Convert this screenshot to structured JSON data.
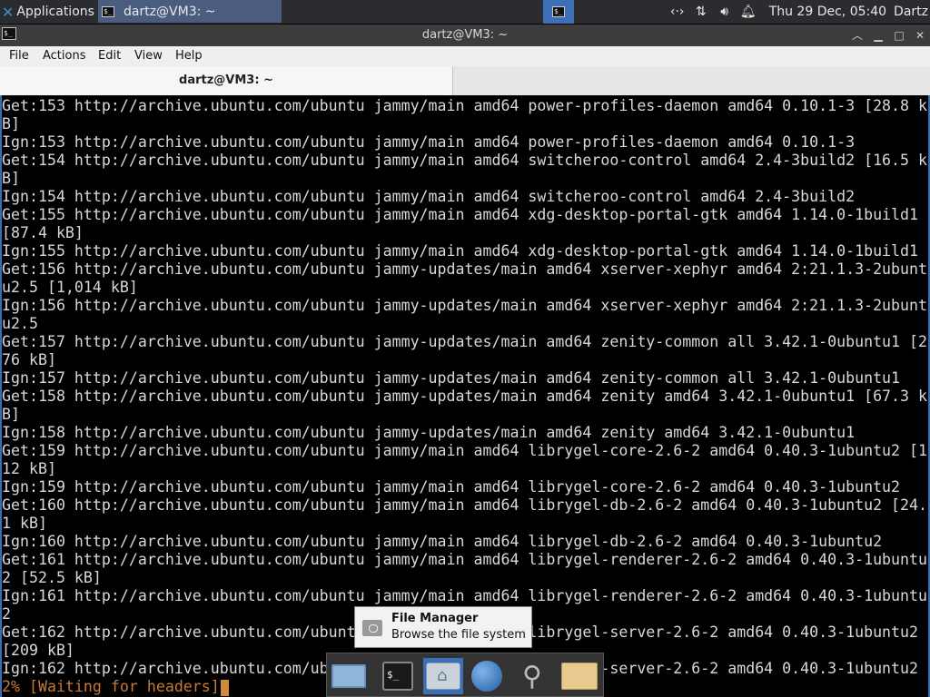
{
  "top_panel": {
    "applications_label": "Applications",
    "task_title": "dartz@VM3: ~",
    "clock": "Thu 29 Dec, 05:40",
    "user": "Dartz",
    "tray_icons": [
      "network-icon",
      "transfer-arrows-icon",
      "volume-icon",
      "notification-bell-icon"
    ]
  },
  "window": {
    "title": "dartz@VM3: ~",
    "controls": [
      "shade-up",
      "minimize",
      "maximize",
      "close"
    ]
  },
  "menubar": {
    "items": [
      "File",
      "Actions",
      "Edit",
      "View",
      "Help"
    ]
  },
  "tabs": [
    {
      "label": "dartz@VM3: ~",
      "active": true
    }
  ],
  "terminal": {
    "lines": [
      "Get:153 http://archive.ubuntu.com/ubuntu jammy/main amd64 power-profiles-daemon amd64 0.10.1-3 [28.8 k",
      "B]",
      "Ign:153 http://archive.ubuntu.com/ubuntu jammy/main amd64 power-profiles-daemon amd64 0.10.1-3",
      "Get:154 http://archive.ubuntu.com/ubuntu jammy/main amd64 switcheroo-control amd64 2.4-3build2 [16.5 k",
      "B]",
      "Ign:154 http://archive.ubuntu.com/ubuntu jammy/main amd64 switcheroo-control amd64 2.4-3build2",
      "Get:155 http://archive.ubuntu.com/ubuntu jammy/main amd64 xdg-desktop-portal-gtk amd64 1.14.0-1build1",
      "[87.4 kB]",
      "Ign:155 http://archive.ubuntu.com/ubuntu jammy/main amd64 xdg-desktop-portal-gtk amd64 1.14.0-1build1",
      "Get:156 http://archive.ubuntu.com/ubuntu jammy-updates/main amd64 xserver-xephyr amd64 2:21.1.3-2ubunt",
      "u2.5 [1,014 kB]",
      "Ign:156 http://archive.ubuntu.com/ubuntu jammy-updates/main amd64 xserver-xephyr amd64 2:21.1.3-2ubunt",
      "u2.5",
      "Get:157 http://archive.ubuntu.com/ubuntu jammy-updates/main amd64 zenity-common all 3.42.1-0ubuntu1 [2",
      "76 kB]",
      "Ign:157 http://archive.ubuntu.com/ubuntu jammy-updates/main amd64 zenity-common all 3.42.1-0ubuntu1",
      "Get:158 http://archive.ubuntu.com/ubuntu jammy-updates/main amd64 zenity amd64 3.42.1-0ubuntu1 [67.3 k",
      "B]",
      "Ign:158 http://archive.ubuntu.com/ubuntu jammy-updates/main amd64 zenity amd64 3.42.1-0ubuntu1",
      "Get:159 http://archive.ubuntu.com/ubuntu jammy/main amd64 librygel-core-2.6-2 amd64 0.40.3-1ubuntu2 [1",
      "12 kB]",
      "Ign:159 http://archive.ubuntu.com/ubuntu jammy/main amd64 librygel-core-2.6-2 amd64 0.40.3-1ubuntu2",
      "Get:160 http://archive.ubuntu.com/ubuntu jammy/main amd64 librygel-db-2.6-2 amd64 0.40.3-1ubuntu2 [24.",
      "1 kB]",
      "Ign:160 http://archive.ubuntu.com/ubuntu jammy/main amd64 librygel-db-2.6-2 amd64 0.40.3-1ubuntu2",
      "Get:161 http://archive.ubuntu.com/ubuntu jammy/main amd64 librygel-renderer-2.6-2 amd64 0.40.3-1ubuntu",
      "2 [52.5 kB]",
      "Ign:161 http://archive.ubuntu.com/ubuntu jammy/main amd64 librygel-renderer-2.6-2 amd64 0.40.3-1ubuntu",
      "2",
      "Get:162 http://archive.ubuntu.com/ubuntu jammy/main amd64 librygel-server-2.6-2 amd64 0.40.3-1ubuntu2",
      "[209 kB]",
      "Ign:162 http://archive.ubuntu.com/ubuntu jammy/main amd64 librygel-server-2.6-2 amd64 0.40.3-1ubuntu2"
    ],
    "progress_line": "2% [Waiting for headers]",
    "progress_color": "#c47a36"
  },
  "tooltip": {
    "title": "File Manager",
    "description": "Browse the file system"
  },
  "dock": {
    "items": [
      {
        "name": "show-desktop",
        "icon": "desktop-icon"
      },
      {
        "name": "terminal",
        "icon": "terminal-icon"
      },
      {
        "name": "home-folder",
        "icon": "home-folder-icon",
        "active": true
      },
      {
        "name": "web-browser",
        "icon": "globe-icon"
      },
      {
        "name": "app-finder",
        "icon": "magnifier-icon"
      },
      {
        "name": "files",
        "icon": "folder-icon"
      }
    ]
  },
  "colors": {
    "panel_bg": "#2a2c30",
    "accent": "#3d6fb7",
    "terminal_bg": "#000000",
    "terminal_fg": "#d8d8d8"
  }
}
